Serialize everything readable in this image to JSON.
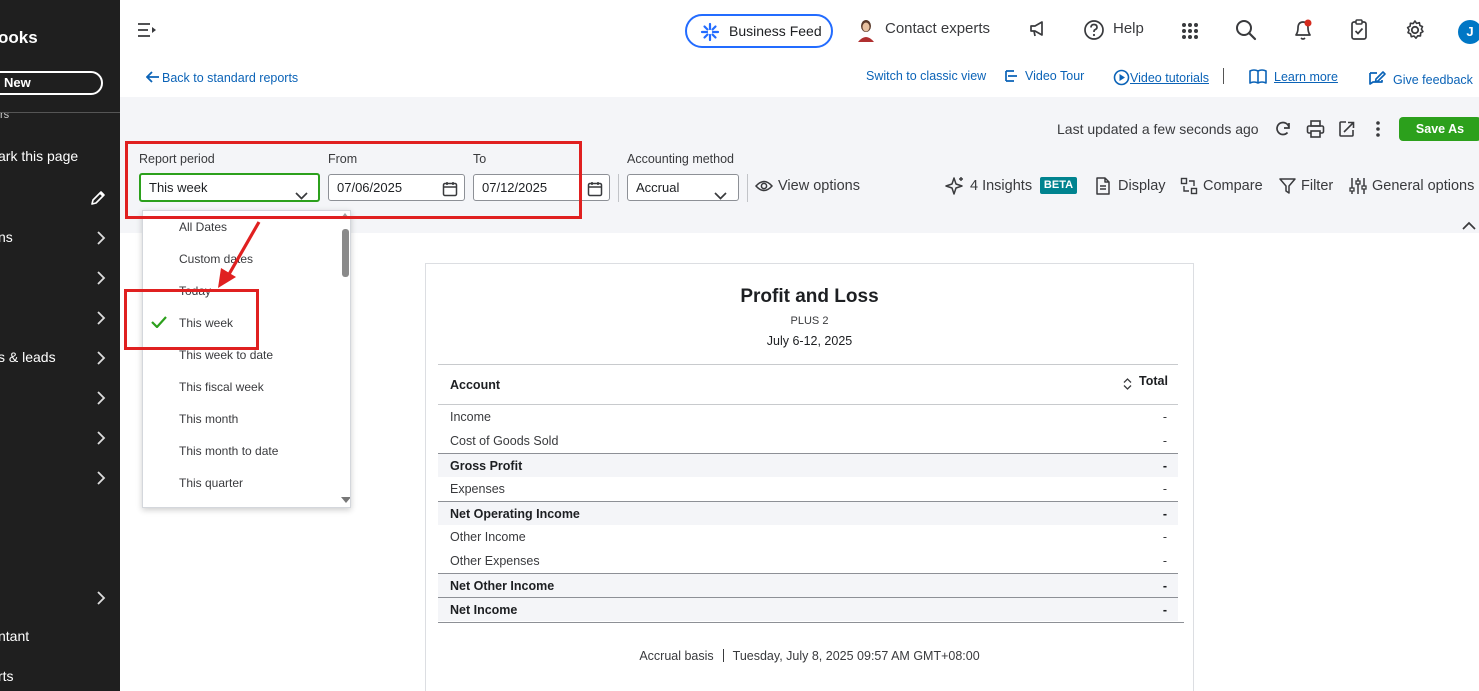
{
  "sidebar": {
    "title": "ooks",
    "new_label": "New",
    "top_fragment": "rs",
    "bookmark": "ark this page",
    "items": [
      {
        "label": "ns"
      },
      {
        "label": ""
      },
      {
        "label": ""
      },
      {
        "label": "s & leads"
      },
      {
        "label": ""
      },
      {
        "label": ""
      },
      {
        "label": ""
      },
      {
        "label": ""
      }
    ],
    "bottom_items": [
      {
        "label": "ntant"
      },
      {
        "label": "rts"
      }
    ]
  },
  "topbar": {
    "business_feed": "Business Feed",
    "contact_experts": "Contact experts",
    "help": "Help",
    "avatar_letter": "J"
  },
  "links": {
    "back": "Back to standard reports",
    "switch_classic": "Switch to classic view",
    "video_tour": "Video Tour",
    "video_tutorials": "Video tutorials",
    "learn_more": "Learn more",
    "give_feedback": "Give feedback"
  },
  "header": {
    "last_updated": "Last updated a few seconds ago",
    "save_as": "Save As",
    "report_period_label": "Report period",
    "report_period_value": "This week",
    "from_label": "From",
    "from_value": "07/06/2025",
    "to_label": "To",
    "to_value": "07/12/2025",
    "accounting_method_label": "Accounting method",
    "accounting_method_value": "Accrual",
    "view_options": "View options",
    "insights": "4 Insights",
    "beta": "BETA",
    "display": "Display",
    "compare": "Compare",
    "filter": "Filter",
    "general_options": "General options"
  },
  "dropdown": {
    "selected": "This week",
    "options": [
      "All Dates",
      "Custom dates",
      "Today",
      "This week",
      "This week to date",
      "This fiscal week",
      "This month",
      "This month to date",
      "This quarter"
    ]
  },
  "report": {
    "title": "Profit and Loss",
    "company": "PLUS 2",
    "period": "July 6-12, 2025",
    "col_account": "Account",
    "col_total": "Total",
    "rows": [
      {
        "account": "Income",
        "total": "-",
        "is_total": false
      },
      {
        "account": "Cost of Goods Sold",
        "total": "-",
        "is_total": false
      },
      {
        "account": "Gross Profit",
        "total": "-",
        "is_total": true
      },
      {
        "account": "Expenses",
        "total": "-",
        "is_total": false
      },
      {
        "account": "Net Operating Income",
        "total": "-",
        "is_total": true
      },
      {
        "account": "Other Income",
        "total": "-",
        "is_total": false
      },
      {
        "account": "Other Expenses",
        "total": "-",
        "is_total": false
      },
      {
        "account": "Net Other Income",
        "total": "-",
        "is_total": true
      },
      {
        "account": "Net Income",
        "total": "-",
        "is_total": true
      }
    ],
    "footer_basis": "Accrual basis",
    "footer_timestamp": "Tuesday, July 8, 2025 09:57 AM GMT+08:00"
  },
  "colors": {
    "primary_blue": "#236cff",
    "link_blue": "#0b63b7",
    "green": "#2ca01c",
    "annotation_red": "#e02020",
    "sidebar_bg": "#1f1f1f",
    "teal": "#00838f"
  }
}
